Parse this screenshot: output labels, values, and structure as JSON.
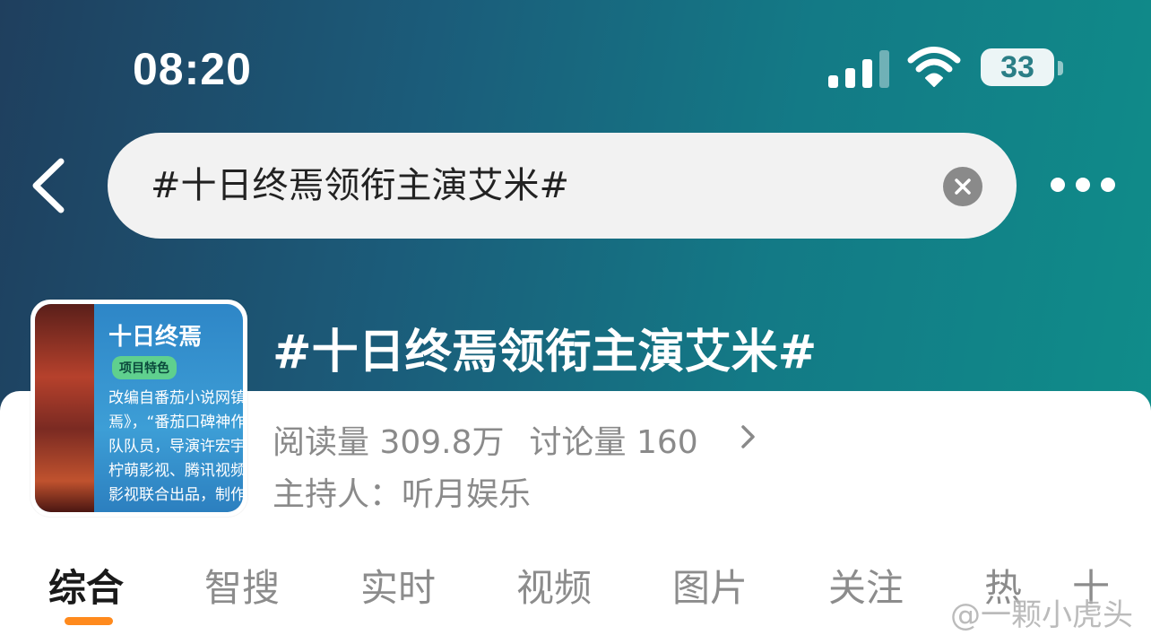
{
  "status_bar": {
    "time": "08:20",
    "battery": "33"
  },
  "search": {
    "query": "#十日终焉领衔主演艾米#"
  },
  "topic": {
    "title": "#十日终焉领衔主演艾米#",
    "reads_label": "阅读量",
    "reads_value": "309.8万",
    "discussion_label": "讨论量",
    "discussion_value": "160",
    "host": "主持人：听月娱乐",
    "cover": {
      "title": "十日终焉",
      "tag": "项目特色",
      "lines": [
        "改编自番茄小说网镇站",
        "焉》，“番茄口碑神作",
        "队队员，导演许宏宇，",
        "柠萌影视、腾讯视频出",
        "影视联合出品，制作方"
      ]
    }
  },
  "tabs": [
    {
      "label": "综合",
      "active": true
    },
    {
      "label": "智搜",
      "active": false
    },
    {
      "label": "实时",
      "active": false
    },
    {
      "label": "视频",
      "active": false
    },
    {
      "label": "图片",
      "active": false
    },
    {
      "label": "关注",
      "active": false
    },
    {
      "label": "热",
      "active": false
    },
    {
      "label": "十",
      "active": false
    }
  ],
  "watermark": "@一颗小虎头",
  "colors": {
    "accent": "#ff8a1d",
    "header_start": "#1f3f5e",
    "header_end": "#0f8e8a",
    "muted_text": "#8a8a8a"
  },
  "icons": [
    "back-arrow-icon",
    "clear-icon",
    "more-dots-icon",
    "chevron-right-icon",
    "signal-icon",
    "wifi-icon",
    "battery-icon"
  ]
}
